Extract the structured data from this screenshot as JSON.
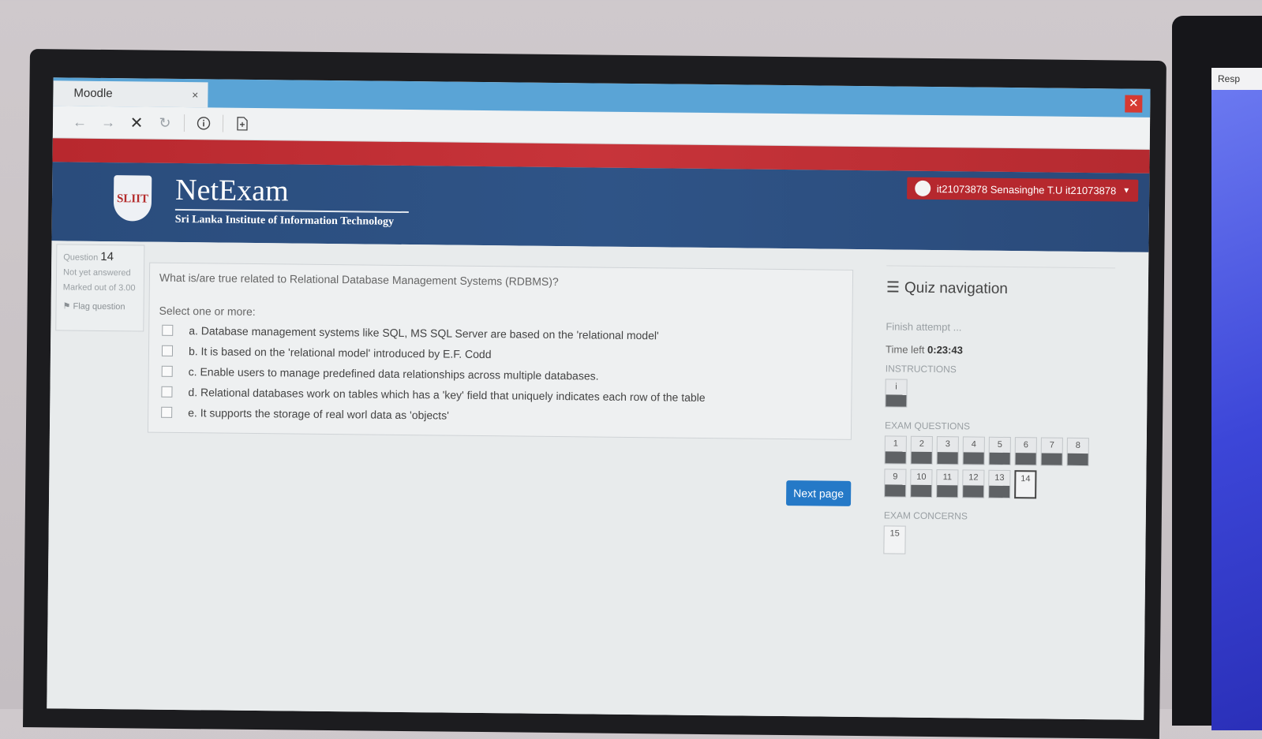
{
  "browser": {
    "tab_title": "Moodle",
    "tab_close": "×",
    "window_close": "✕",
    "right_tab_fragment": "Resp"
  },
  "header": {
    "crest_text": "SLIIT",
    "brand": "NetExam",
    "subtitle": "Sri Lanka Institute of Information Technology",
    "user": "it21073878 Senasinghe T.U it21073878"
  },
  "question_info": {
    "label": "Question",
    "number": "14",
    "status": "Not yet answered",
    "marked": "Marked out of 3.00",
    "flag": "Flag question"
  },
  "question": {
    "text": "What is/are true related to Relational Database Management Systems (RDBMS)?",
    "select_label": "Select one or more:",
    "options": [
      {
        "label": "a. Database management systems like SQL, MS SQL Server are based on the 'relational model'",
        "checked": false
      },
      {
        "label": "b. It is based on the 'relational model' introduced by E.F. Codd",
        "checked": false
      },
      {
        "label": "c. Enable users to manage predefined data relationships across multiple databases.",
        "checked": false
      },
      {
        "label": "d. Relational databases work on tables which has a 'key' field that uniquely indicates each row of the table",
        "checked": false
      },
      {
        "label": "e. It supports the storage of real worl data as 'objects'",
        "checked": false
      }
    ]
  },
  "next_button": "Next page",
  "quiz_nav": {
    "title": "Quiz navigation",
    "finish": "Finish attempt ...",
    "time_label": "Time left",
    "time_value": "0:23:43",
    "instructions_label": "INSTRUCTIONS",
    "instructions_button": "i",
    "exam_questions_label": "EXAM QUESTIONS",
    "exam_questions": [
      "1",
      "2",
      "3",
      "4",
      "5",
      "6",
      "7",
      "8",
      "9",
      "10",
      "11",
      "12",
      "13",
      "14"
    ],
    "current_question": "14",
    "exam_concerns_label": "EXAM CONCERNS",
    "exam_concerns": [
      "15"
    ]
  }
}
